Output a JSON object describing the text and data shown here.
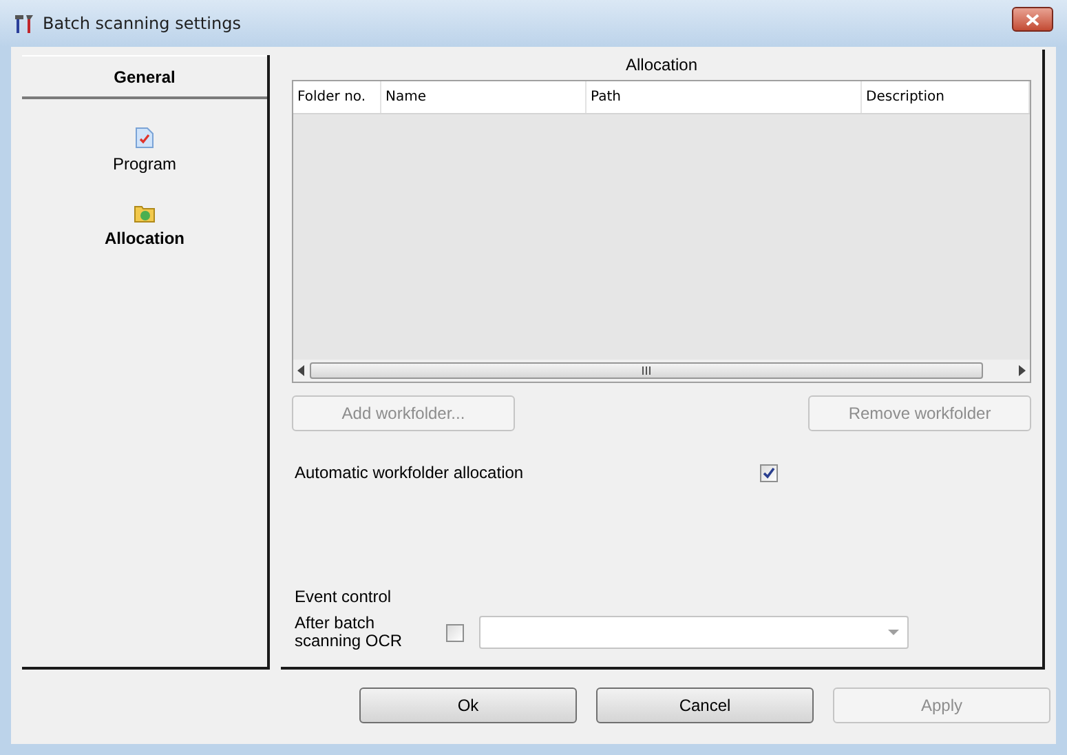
{
  "window": {
    "title": "Batch scanning settings"
  },
  "sidebar": {
    "header": "General",
    "items": [
      {
        "label": "Program",
        "kind": "program",
        "selected": false
      },
      {
        "label": "Allocation",
        "kind": "allocation",
        "selected": true
      }
    ]
  },
  "panel": {
    "title": "Allocation",
    "table": {
      "columns": [
        "Folder no.",
        "Name",
        "Path",
        "Description"
      ]
    },
    "buttons": [
      {
        "label": "Add workfolder...",
        "disabled": true
      },
      {
        "label": "Remove workfolder",
        "disabled": true
      }
    ],
    "auto_allocation": {
      "label": "Automatic workfolder allocation",
      "checked": true
    },
    "event_control": {
      "title": "Event control",
      "label": "After batch scanning OCR",
      "checked": false
    }
  },
  "footer_buttons": [
    {
      "label": "Ok",
      "disabled": false
    },
    {
      "label": "Cancel",
      "disabled": false
    },
    {
      "label": "Apply",
      "disabled": true
    }
  ]
}
